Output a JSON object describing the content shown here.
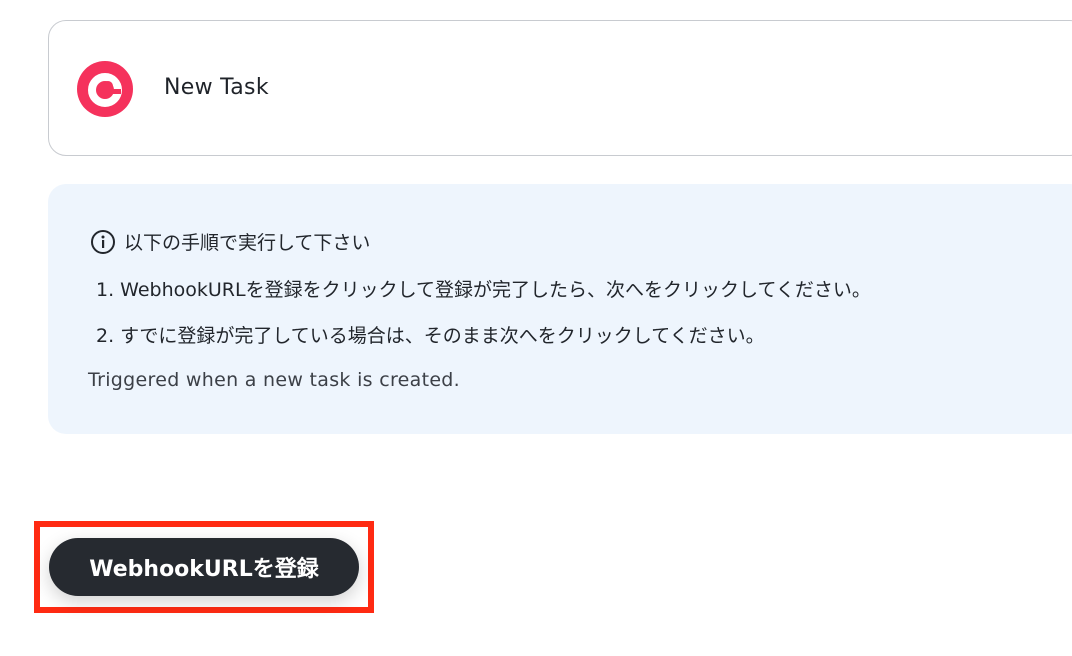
{
  "trigger": {
    "title": "New Task",
    "logo_icon": "app-logo-icon",
    "logo_color": "#f5325c"
  },
  "info": {
    "header": "以下の手順で実行して下さい",
    "icon": "info-circle-icon",
    "steps": [
      "1. WebhookURLを登録をクリックして登録が完了したら、次へをクリックしてください。",
      "2. すでに登録が完了している場合は、そのまま次へをクリックしてください。"
    ],
    "description": "Triggered when a new task is created.",
    "background": "#eef5fd"
  },
  "actions": {
    "register_label": "WebhookURLを登録",
    "highlight_color": "#ff2a12",
    "button_color": "#262a30"
  }
}
